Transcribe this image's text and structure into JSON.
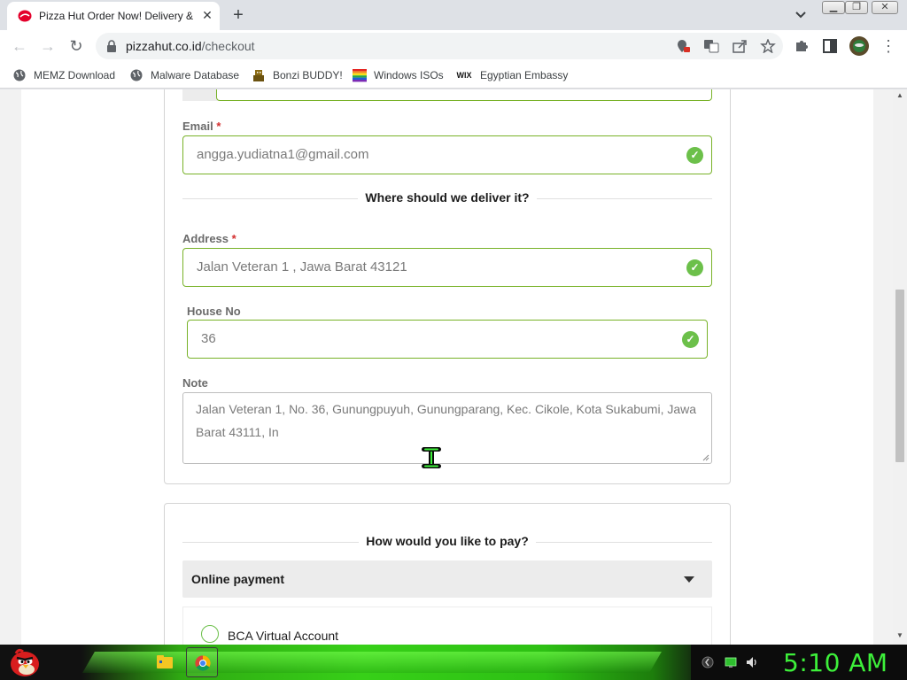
{
  "browser": {
    "tab": {
      "title": "Pizza Hut Order Now! Delivery &"
    },
    "url": {
      "domain": "pizzahut.co.id",
      "path": "/checkout"
    },
    "bookmarks": [
      {
        "label": "MEMZ Download",
        "icon": "globe-icon"
      },
      {
        "label": "Malware Database",
        "icon": "globe-icon"
      },
      {
        "label": "Bonzi BUDDY!",
        "icon": "bonzi-icon"
      },
      {
        "label": "Windows ISOs",
        "icon": "windows-flag-icon"
      },
      {
        "label": "Egyptian Embassy",
        "icon": "wix-icon"
      }
    ],
    "wix_icon_text": "WIX"
  },
  "form": {
    "email": {
      "label": "Email",
      "required_mark": "*",
      "value": "angga.yudiatna1@gmail.com"
    },
    "delivery_heading": "Where should we deliver it?",
    "address": {
      "label": "Address",
      "required_mark": "*",
      "value": "Jalan Veteran 1 , Jawa Barat 43121"
    },
    "house_no": {
      "label": "House No",
      "value": "36"
    },
    "note": {
      "label": "Note",
      "value": "Jalan Veteran 1, No. 36, Gunungpuyuh, Gunungparang, Kec. Cikole, Kota Sukabumi, Jawa Barat 43111, In"
    }
  },
  "payment": {
    "heading": "How would you like to pay?",
    "selected": "Online payment",
    "options": [
      {
        "label": "BCA Virtual Account"
      }
    ]
  },
  "taskbar": {
    "clock": "5:10 AM"
  },
  "colors": {
    "valid_border": "#78b228",
    "check_green": "#6cc04a",
    "required_red": "#d32f2f",
    "clock_green": "#3df03a"
  }
}
